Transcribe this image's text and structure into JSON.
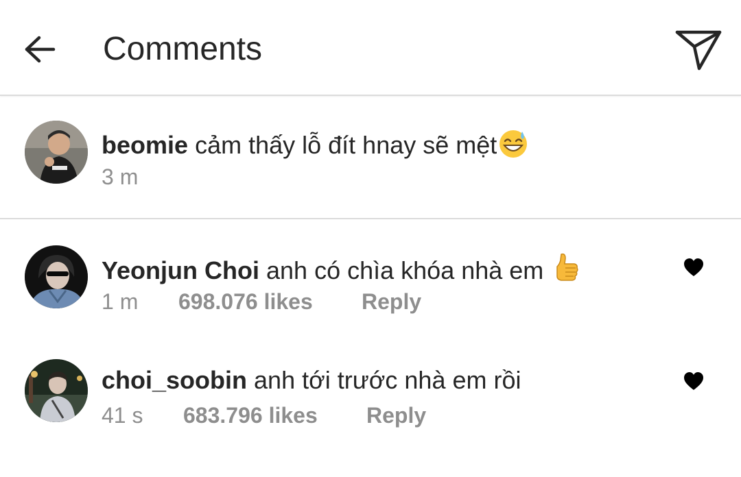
{
  "header": {
    "title": "Comments",
    "back_icon": "arrow-left-icon",
    "send_icon": "paper-plane-icon"
  },
  "caption": {
    "username": "beomie",
    "text": "cảm thấy lỗ đít hnay sẽ mệt",
    "emoji": "grinning-sweat-emoji",
    "time": "3 m"
  },
  "comments": [
    {
      "username": "Yeonjun Choi",
      "text": "anh có chìa khóa nhà em ",
      "emoji": "thumbs-up-emoji",
      "time": "1 m",
      "likes": "698.076 likes",
      "reply": "Reply"
    },
    {
      "username": "choi_soobin",
      "text": "anh tới trước nhà em rồi",
      "time": "41 s",
      "likes": "683.796 likes",
      "reply": "Reply"
    }
  ],
  "colors": {
    "text": "#262626",
    "secondary": "#8e8e8e",
    "divider": "#dbdbdb",
    "heart": "#000000"
  }
}
